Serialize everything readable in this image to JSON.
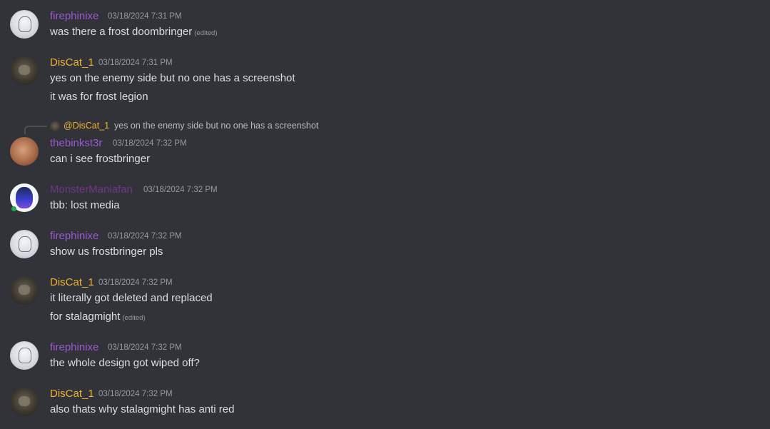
{
  "messages": [
    {
      "author": "firephinixe",
      "timestamp": "03/18/2024 7:31 PM",
      "lines": [
        "was there a frost doombringer"
      ],
      "edited_label": "(edited)",
      "name_color": "#9b59d0"
    },
    {
      "author": "DisCat_1",
      "timestamp": "03/18/2024 7:31 PM",
      "lines": [
        "yes on the enemy side but no one has a screenshot",
        "it was for frost legion"
      ],
      "name_color": "#f0b232"
    },
    {
      "author": "thebinkst3r",
      "timestamp": "03/18/2024 7:32 PM",
      "lines": [
        "can i see frostbringer"
      ],
      "name_color": "#9b59d0",
      "reply": {
        "mention": "@DisCat_1",
        "text": "yes on the enemy side but no one has a screenshot"
      }
    },
    {
      "author": "MonsterManiafan",
      "timestamp": "03/18/2024 7:32 PM",
      "lines": [
        "tbb: lost media"
      ],
      "name_color": "#71368a"
    },
    {
      "author": "firephinixe",
      "timestamp": "03/18/2024 7:32 PM",
      "lines": [
        "show us frostbringer pls"
      ],
      "name_color": "#9b59d0"
    },
    {
      "author": "DisCat_1",
      "timestamp": "03/18/2024 7:32 PM",
      "lines": [
        "it literally got deleted and replaced",
        "for stalagmight"
      ],
      "edited_label": "(edited)",
      "name_color": "#f0b232"
    },
    {
      "author": "firephinixe",
      "timestamp": "03/18/2024 7:32 PM",
      "lines": [
        "the whole design got wiped off?"
      ],
      "name_color": "#9b59d0"
    },
    {
      "author": "DisCat_1",
      "timestamp": "03/18/2024 7:32 PM",
      "lines": [
        "also thats why stalagmight has anti red"
      ],
      "name_color": "#f0b232"
    }
  ]
}
